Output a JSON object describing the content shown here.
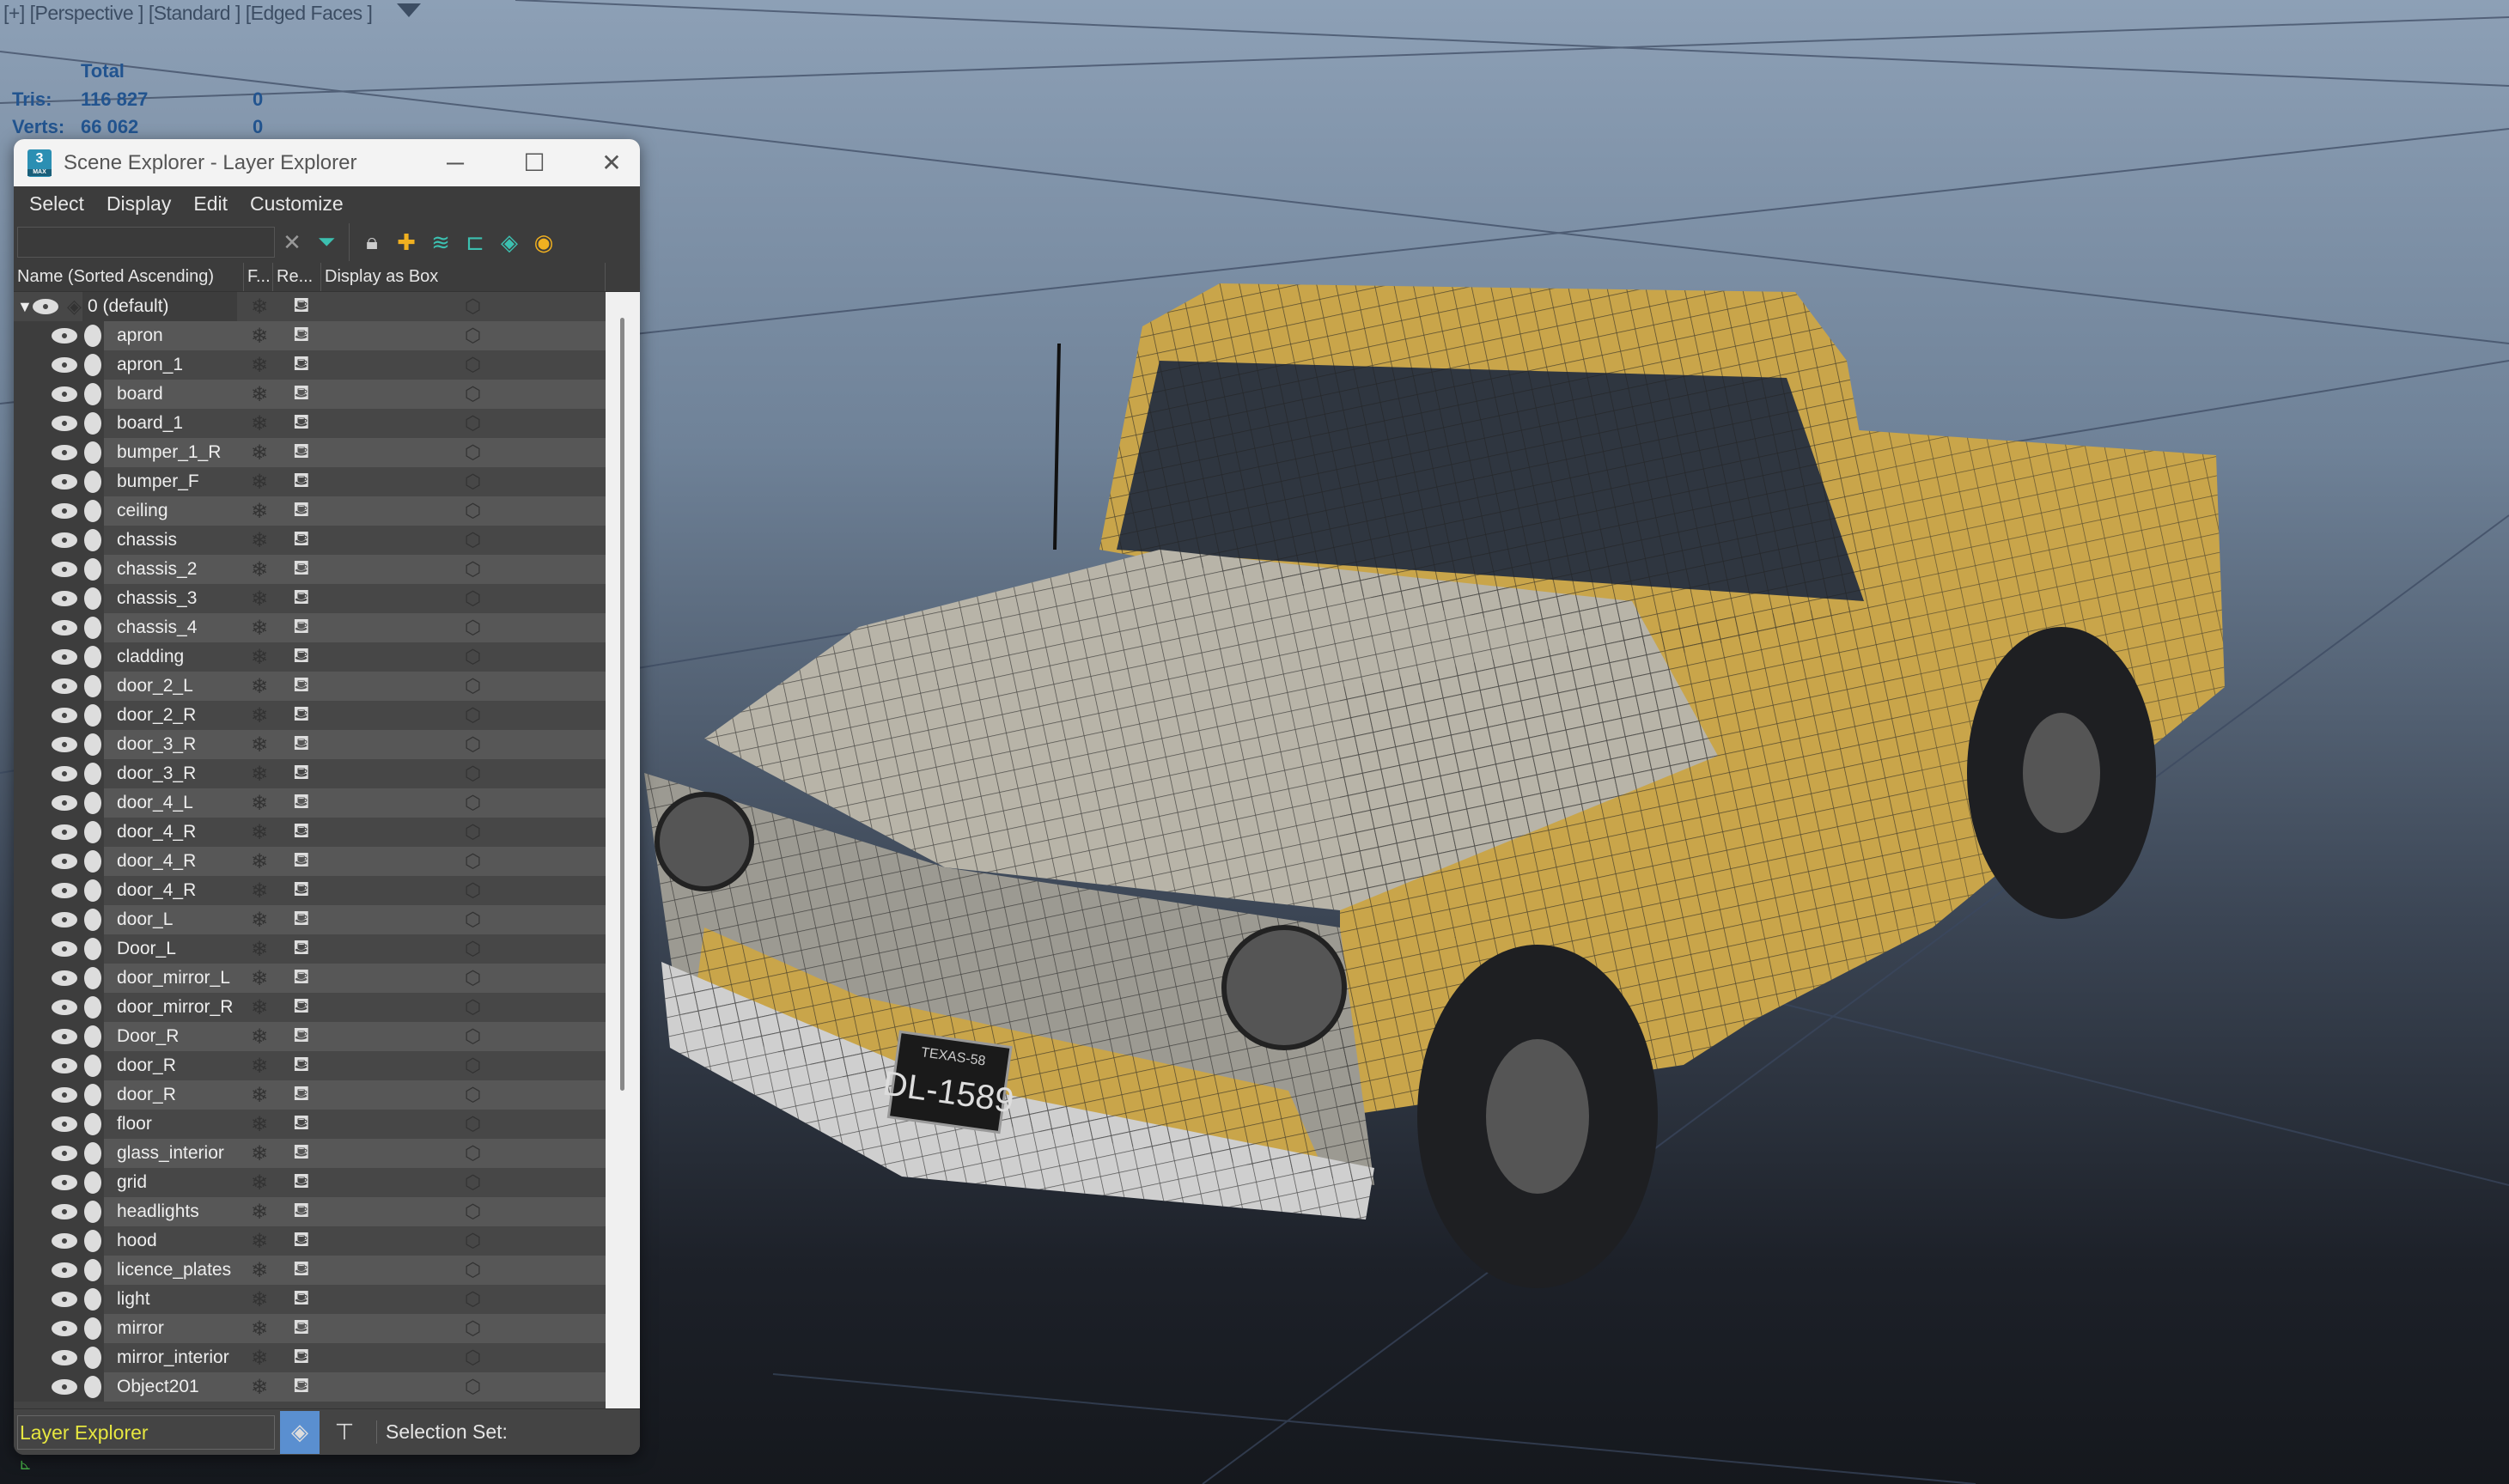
{
  "viewport": {
    "label": "[+] [Perspective ] [Standard ] [Edged Faces ]",
    "stats": {
      "header": "Total",
      "tris_label": "Tris:",
      "tris_value": "116 827",
      "tris_sel": "0",
      "verts_label": "Verts:",
      "verts_value": "66 062",
      "verts_sel": "0"
    },
    "plate_text": "DL-1589",
    "plate_state": "TEXAS-58"
  },
  "window": {
    "title": "Scene Explorer - Layer Explorer",
    "app_icon": "3",
    "app_icon_sub": "MAX"
  },
  "menu": [
    "Select",
    "Display",
    "Edit",
    "Customize"
  ],
  "toolbar": {
    "search_value": "",
    "icons": [
      "clear-x-icon",
      "filter-icon",
      "lock-icon",
      "add-layer-icon",
      "move-to-layer-icon",
      "hierarchy-icon",
      "layers-icon",
      "hide-layer-icon"
    ]
  },
  "columns": [
    "Name (Sorted Ascending)",
    "F...",
    "Re...",
    "Display as Box"
  ],
  "root_layer": "0 (default)",
  "layers": [
    "apron",
    "apron_1",
    "board",
    "board_1",
    "bumper_1_R",
    "bumper_F",
    "ceiling",
    "chassis",
    "chassis_2",
    "chassis_3",
    "chassis_4",
    "cladding",
    "door_2_L",
    "door_2_R",
    "door_3_R",
    "door_3_R",
    "door_4_L",
    "door_4_R",
    "door_4_R",
    "door_4_R",
    "door_L",
    "Door_L",
    "door_mirror_L",
    "door_mirror_R",
    "Door_R",
    "door_R",
    "door_R",
    "floor",
    "glass_interior",
    "grid",
    "headlights",
    "hood",
    "licence_plates",
    "light",
    "mirror",
    "mirror_interior",
    "Object201"
  ],
  "bottom": {
    "mode": "Layer Explorer",
    "selection_set_label": "Selection Set:"
  },
  "colors": {
    "accent": "#5a8fd0",
    "mode_text": "#e6e640",
    "stats": "#22548f",
    "truck_yellow": "#c9a54a"
  }
}
